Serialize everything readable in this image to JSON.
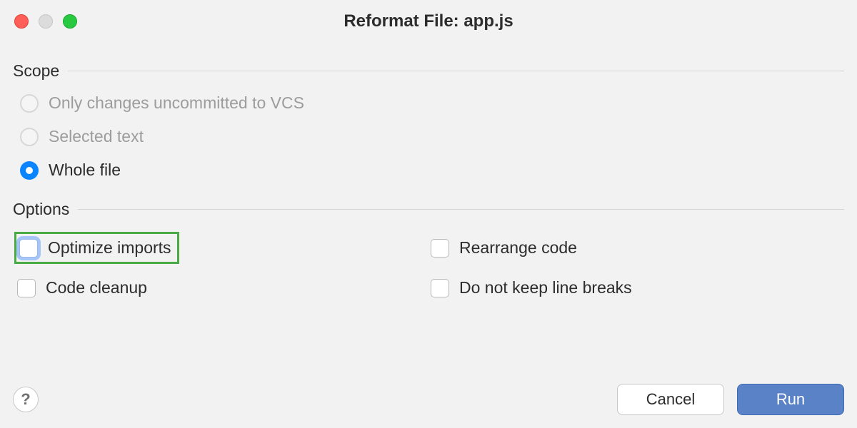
{
  "window": {
    "title": "Reformat File: app.js"
  },
  "sections": {
    "scope_label": "Scope",
    "options_label": "Options"
  },
  "scope": {
    "only_uncommitted": {
      "label": "Only changes uncommitted to VCS",
      "enabled": false,
      "selected": false
    },
    "selected_text": {
      "label": "Selected text",
      "enabled": false,
      "selected": false
    },
    "whole_file": {
      "label": "Whole file",
      "enabled": true,
      "selected": true
    }
  },
  "options": {
    "optimize_imports": {
      "label": "Optimize imports",
      "checked": false,
      "focused": true,
      "highlighted": true
    },
    "rearrange_code": {
      "label": "Rearrange code",
      "checked": false
    },
    "code_cleanup": {
      "label": "Code cleanup",
      "checked": false
    },
    "do_not_keep_line_breaks": {
      "label": "Do not keep line breaks",
      "checked": false
    }
  },
  "footer": {
    "help_glyph": "?",
    "cancel": "Cancel",
    "run": "Run"
  }
}
